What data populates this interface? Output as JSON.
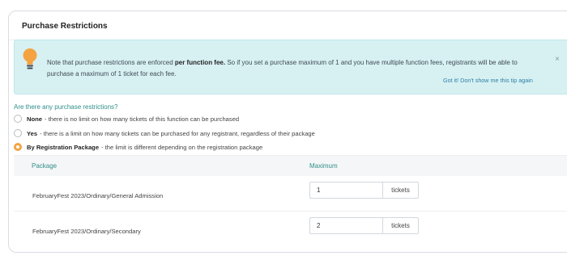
{
  "card": {
    "title": "Purchase Restrictions"
  },
  "tip": {
    "icon": "lightbulb-icon",
    "text_before": "Note that purchase restrictions are enforced ",
    "text_bold": "per function fee.",
    "text_after": " So if you set a purchase maximum of 1 and you have multiple function fees, registrants will be able to purchase a maximum of 1 ticket for each fee.",
    "close_label": "×",
    "dismiss_link": "Got it! Don't show me this tip again"
  },
  "restrictions": {
    "question": "Are there any purchase restrictions?",
    "options": [
      {
        "label": "None",
        "description": " - there is no limit on how many tickets of this function can be purchased",
        "selected": false
      },
      {
        "label": "Yes",
        "description": " - there is a limit on how many tickets can be purchased for any registrant, regardless of their package",
        "selected": false
      },
      {
        "label": "By Registration Package",
        "description": " - the limit is different depending on the registration package",
        "selected": true
      }
    ]
  },
  "packages_table": {
    "headers": {
      "package": "Package",
      "maximum": "Maximum"
    },
    "rows": [
      {
        "package": "FebruaryFest 2023/Ordinary/General Admission",
        "maximum": "1",
        "unit": "tickets"
      },
      {
        "package": "FebruaryFest 2023/Ordinary/Secondary",
        "maximum": "2",
        "unit": "tickets"
      }
    ]
  },
  "colors": {
    "accent": "#2f8f8a",
    "tip_background": "#d7f1f3",
    "radio_selected": "#f4a340",
    "link": "#2f7fa3"
  }
}
